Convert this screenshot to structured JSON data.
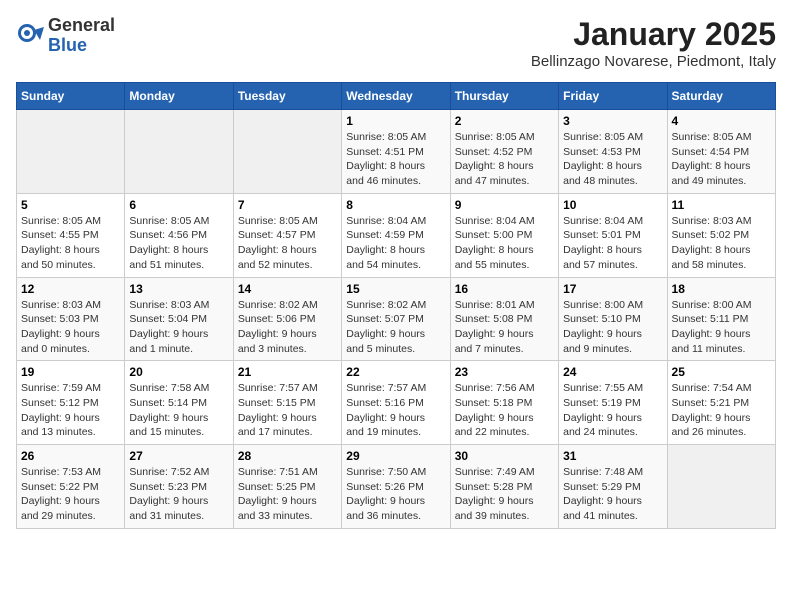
{
  "header": {
    "logo_general": "General",
    "logo_blue": "Blue",
    "month_title": "January 2025",
    "subtitle": "Bellinzago Novarese, Piedmont, Italy"
  },
  "weekdays": [
    "Sunday",
    "Monday",
    "Tuesday",
    "Wednesday",
    "Thursday",
    "Friday",
    "Saturday"
  ],
  "weeks": [
    [
      {
        "day": "",
        "info": ""
      },
      {
        "day": "",
        "info": ""
      },
      {
        "day": "",
        "info": ""
      },
      {
        "day": "1",
        "info": "Sunrise: 8:05 AM\nSunset: 4:51 PM\nDaylight: 8 hours\nand 46 minutes."
      },
      {
        "day": "2",
        "info": "Sunrise: 8:05 AM\nSunset: 4:52 PM\nDaylight: 8 hours\nand 47 minutes."
      },
      {
        "day": "3",
        "info": "Sunrise: 8:05 AM\nSunset: 4:53 PM\nDaylight: 8 hours\nand 48 minutes."
      },
      {
        "day": "4",
        "info": "Sunrise: 8:05 AM\nSunset: 4:54 PM\nDaylight: 8 hours\nand 49 minutes."
      }
    ],
    [
      {
        "day": "5",
        "info": "Sunrise: 8:05 AM\nSunset: 4:55 PM\nDaylight: 8 hours\nand 50 minutes."
      },
      {
        "day": "6",
        "info": "Sunrise: 8:05 AM\nSunset: 4:56 PM\nDaylight: 8 hours\nand 51 minutes."
      },
      {
        "day": "7",
        "info": "Sunrise: 8:05 AM\nSunset: 4:57 PM\nDaylight: 8 hours\nand 52 minutes."
      },
      {
        "day": "8",
        "info": "Sunrise: 8:04 AM\nSunset: 4:59 PM\nDaylight: 8 hours\nand 54 minutes."
      },
      {
        "day": "9",
        "info": "Sunrise: 8:04 AM\nSunset: 5:00 PM\nDaylight: 8 hours\nand 55 minutes."
      },
      {
        "day": "10",
        "info": "Sunrise: 8:04 AM\nSunset: 5:01 PM\nDaylight: 8 hours\nand 57 minutes."
      },
      {
        "day": "11",
        "info": "Sunrise: 8:03 AM\nSunset: 5:02 PM\nDaylight: 8 hours\nand 58 minutes."
      }
    ],
    [
      {
        "day": "12",
        "info": "Sunrise: 8:03 AM\nSunset: 5:03 PM\nDaylight: 9 hours\nand 0 minutes."
      },
      {
        "day": "13",
        "info": "Sunrise: 8:03 AM\nSunset: 5:04 PM\nDaylight: 9 hours\nand 1 minute."
      },
      {
        "day": "14",
        "info": "Sunrise: 8:02 AM\nSunset: 5:06 PM\nDaylight: 9 hours\nand 3 minutes."
      },
      {
        "day": "15",
        "info": "Sunrise: 8:02 AM\nSunset: 5:07 PM\nDaylight: 9 hours\nand 5 minutes."
      },
      {
        "day": "16",
        "info": "Sunrise: 8:01 AM\nSunset: 5:08 PM\nDaylight: 9 hours\nand 7 minutes."
      },
      {
        "day": "17",
        "info": "Sunrise: 8:00 AM\nSunset: 5:10 PM\nDaylight: 9 hours\nand 9 minutes."
      },
      {
        "day": "18",
        "info": "Sunrise: 8:00 AM\nSunset: 5:11 PM\nDaylight: 9 hours\nand 11 minutes."
      }
    ],
    [
      {
        "day": "19",
        "info": "Sunrise: 7:59 AM\nSunset: 5:12 PM\nDaylight: 9 hours\nand 13 minutes."
      },
      {
        "day": "20",
        "info": "Sunrise: 7:58 AM\nSunset: 5:14 PM\nDaylight: 9 hours\nand 15 minutes."
      },
      {
        "day": "21",
        "info": "Sunrise: 7:57 AM\nSunset: 5:15 PM\nDaylight: 9 hours\nand 17 minutes."
      },
      {
        "day": "22",
        "info": "Sunrise: 7:57 AM\nSunset: 5:16 PM\nDaylight: 9 hours\nand 19 minutes."
      },
      {
        "day": "23",
        "info": "Sunrise: 7:56 AM\nSunset: 5:18 PM\nDaylight: 9 hours\nand 22 minutes."
      },
      {
        "day": "24",
        "info": "Sunrise: 7:55 AM\nSunset: 5:19 PM\nDaylight: 9 hours\nand 24 minutes."
      },
      {
        "day": "25",
        "info": "Sunrise: 7:54 AM\nSunset: 5:21 PM\nDaylight: 9 hours\nand 26 minutes."
      }
    ],
    [
      {
        "day": "26",
        "info": "Sunrise: 7:53 AM\nSunset: 5:22 PM\nDaylight: 9 hours\nand 29 minutes."
      },
      {
        "day": "27",
        "info": "Sunrise: 7:52 AM\nSunset: 5:23 PM\nDaylight: 9 hours\nand 31 minutes."
      },
      {
        "day": "28",
        "info": "Sunrise: 7:51 AM\nSunset: 5:25 PM\nDaylight: 9 hours\nand 33 minutes."
      },
      {
        "day": "29",
        "info": "Sunrise: 7:50 AM\nSunset: 5:26 PM\nDaylight: 9 hours\nand 36 minutes."
      },
      {
        "day": "30",
        "info": "Sunrise: 7:49 AM\nSunset: 5:28 PM\nDaylight: 9 hours\nand 39 minutes."
      },
      {
        "day": "31",
        "info": "Sunrise: 7:48 AM\nSunset: 5:29 PM\nDaylight: 9 hours\nand 41 minutes."
      },
      {
        "day": "",
        "info": ""
      }
    ]
  ]
}
